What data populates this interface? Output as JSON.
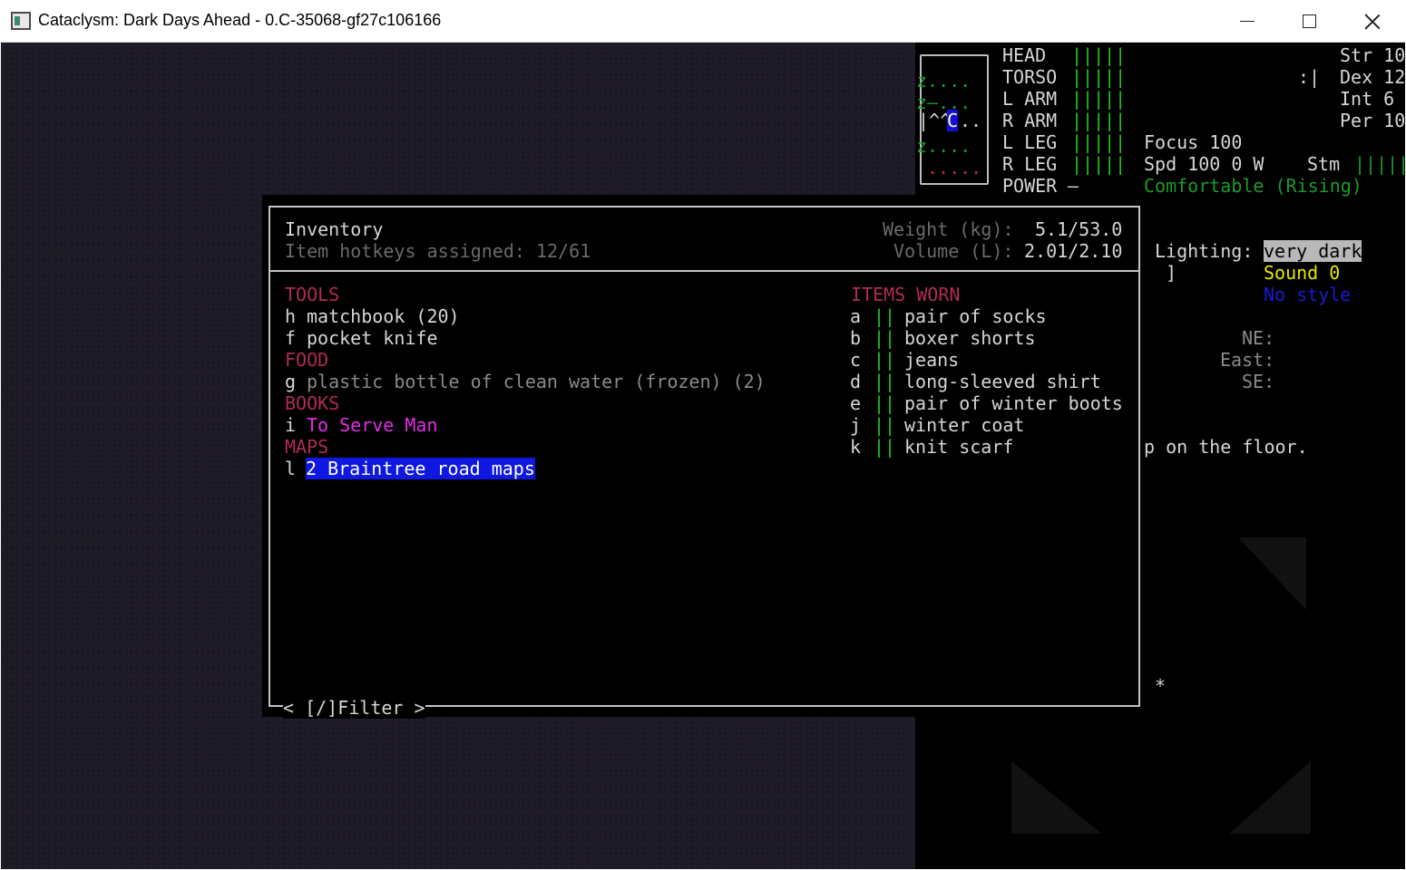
{
  "window": {
    "title": "Cataclysm: Dark Days Ahead - 0.C-35068-gf27c106166"
  },
  "sidebar": {
    "body_parts": [
      {
        "label": "HEAD",
        "bar": "|||||"
      },
      {
        "label": "TORSO",
        "bar": "|||||"
      },
      {
        "label": "L ARM",
        "bar": "|||||"
      },
      {
        "label": "R ARM",
        "bar": "|||||"
      },
      {
        "label": "L LEG",
        "bar": "|||||"
      },
      {
        "label": "R LEG",
        "bar": "|||||"
      }
    ],
    "power_label": "POWER",
    "power_value": "—",
    "stats": {
      "str": "Str 10",
      "dex": "Dex 12",
      "int": "Int 6",
      "per": "Per 10"
    },
    "mood_face": ":|",
    "focus": "Focus 100",
    "speed": "Spd 100 0 W",
    "stamina_label": "Stm",
    "stamina_bar": "|||||",
    "temperature": "Comfortable (Rising)",
    "lighting_label": "Lighting:",
    "lighting_value": "very dark",
    "bracket": "]",
    "sound": "Sound 0",
    "style": "No style",
    "compass": {
      "ne": "NE:",
      "east": "East:",
      "se": "SE:"
    },
    "log_line": "p on the floor."
  },
  "minimap": {
    "rows": [
      "z....",
      "z—...",
      "|^^",
      "z....",
      "....."
    ],
    "player": "C",
    "player_trail": ".."
  },
  "inventory": {
    "title": "Inventory",
    "hotkeys": "Item hotkeys assigned: 12/61",
    "weight_label": "Weight (kg):",
    "weight_value": "5.1/53.0",
    "volume_label": "Volume (L):",
    "volume_value": "2.01/2.10",
    "filter": "< [/]Filter >",
    "left_sections": [
      {
        "category": "TOOLS",
        "items": [
          {
            "key": "h",
            "name": "matchbook (20)"
          },
          {
            "key": "f",
            "name": "pocket knife"
          }
        ]
      },
      {
        "category": "FOOD",
        "items": [
          {
            "key": "g",
            "name": "plastic bottle of clean water (frozen) (2)"
          }
        ]
      },
      {
        "category": "BOOKS",
        "items": [
          {
            "key": "i",
            "name": "To Serve Man"
          }
        ]
      },
      {
        "category": "MAPS",
        "items": [
          {
            "key": "l",
            "name": "2 Braintree road maps"
          }
        ]
      }
    ],
    "worn_header": "ITEMS WORN",
    "worn_marker": "||",
    "worn_items": [
      {
        "key": "a",
        "name": "pair of socks"
      },
      {
        "key": "b",
        "name": "boxer shorts"
      },
      {
        "key": "c",
        "name": "jeans"
      },
      {
        "key": "d",
        "name": "long-sleeved shirt"
      },
      {
        "key": "e",
        "name": "pair of winter boots"
      },
      {
        "key": "j",
        "name": "winter coat"
      },
      {
        "key": "k",
        "name": "knit scarf"
      }
    ]
  },
  "map_glyph": "*"
}
